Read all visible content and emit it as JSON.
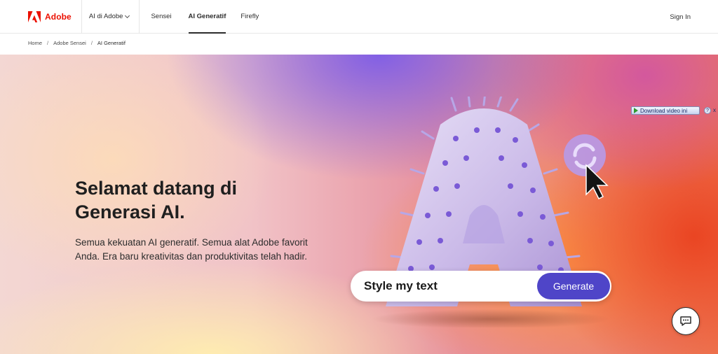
{
  "brand": {
    "name": "Adobe",
    "logo_icon": "adobe-logo-icon",
    "color": "#eb1000"
  },
  "nav": {
    "items": [
      {
        "label": "AI di Adobe",
        "has_dropdown": true
      },
      {
        "label": "Sensei"
      },
      {
        "label": "AI Generatif",
        "active": true
      },
      {
        "label": "Firefly"
      }
    ],
    "sign_in": "Sign In"
  },
  "breadcrumb": {
    "items": [
      "Home",
      "Adobe Sensei",
      "AI Generatif"
    ],
    "separator": "/"
  },
  "download_banner": {
    "label": "Download video ini",
    "help": "?",
    "close": "x"
  },
  "hero": {
    "title_line1": "Selamat datang di",
    "title_line2": "Generasi AI.",
    "subtitle_line1": "Semua kekuatan AI generatif. Semua alat Adobe favorit",
    "subtitle_line2": "Anda. Era baru kreativitas dan produktivitas telah hadir."
  },
  "generate_bar": {
    "prompt_text": "Style my text",
    "button_label": "Generate",
    "button_color": "#4f45c8"
  },
  "icons": {
    "refresh": "refresh-icon",
    "cursor": "cursor-arrow-icon",
    "chat": "chat-icon"
  }
}
